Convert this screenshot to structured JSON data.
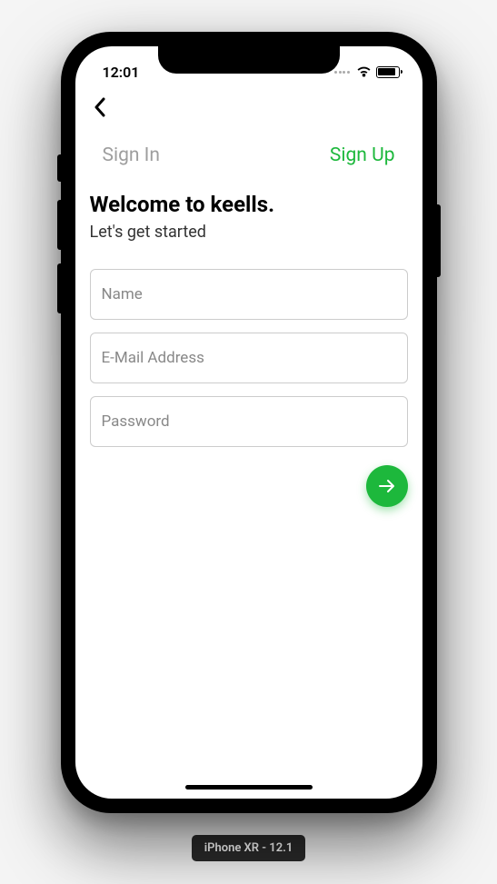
{
  "status": {
    "time": "12:01"
  },
  "tabs": {
    "signin": "Sign In",
    "signup": "Sign Up"
  },
  "heading": {
    "title": "Welcome to keells.",
    "subtitle": "Let's get started"
  },
  "form": {
    "name_placeholder": "Name",
    "email_placeholder": "E-Mail Address",
    "password_placeholder": "Password"
  },
  "device_label": "iPhone XR - 12.1"
}
